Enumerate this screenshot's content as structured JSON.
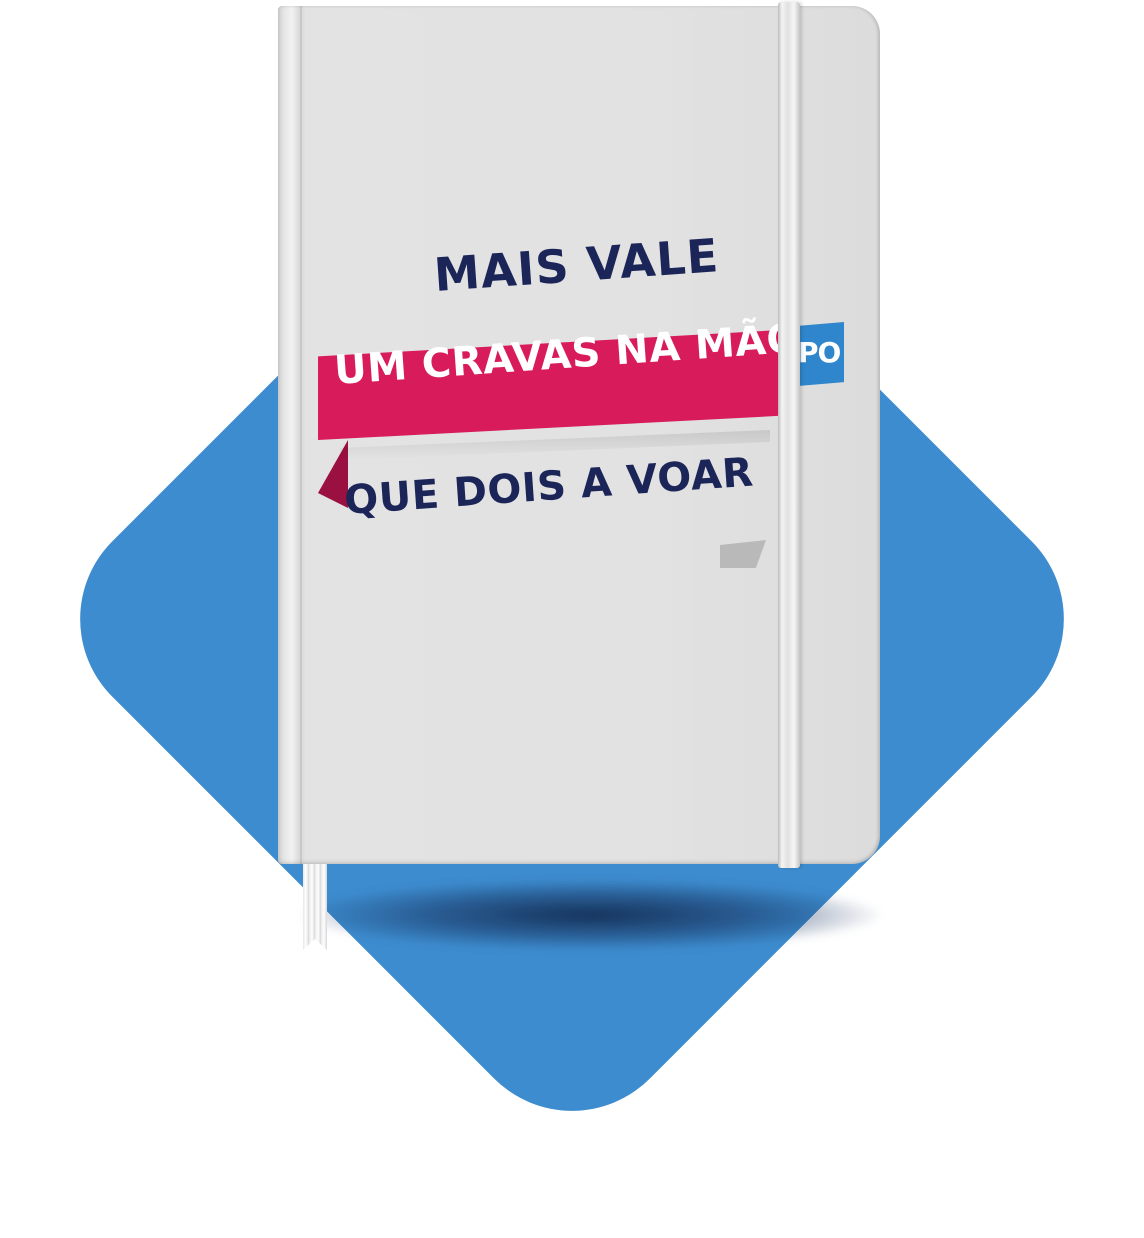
{
  "cover": {
    "line1": "MAIS VALE",
    "line2": "UM CRAVAS NA MÃO",
    "line3": "QUE DOIS A VOAR",
    "tag_text": "PO"
  },
  "colors": {
    "background_shape": "#3d8ccf",
    "notebook": "#e2e2e2",
    "ribbon": "#d81b5a",
    "text_dark": "#1c2558",
    "text_light": "#ffffff",
    "tag": "#2f86cc"
  },
  "shapes": {
    "background": "rounded-diamond",
    "object": "notebook-with-elastic-band-and-bookmark"
  }
}
